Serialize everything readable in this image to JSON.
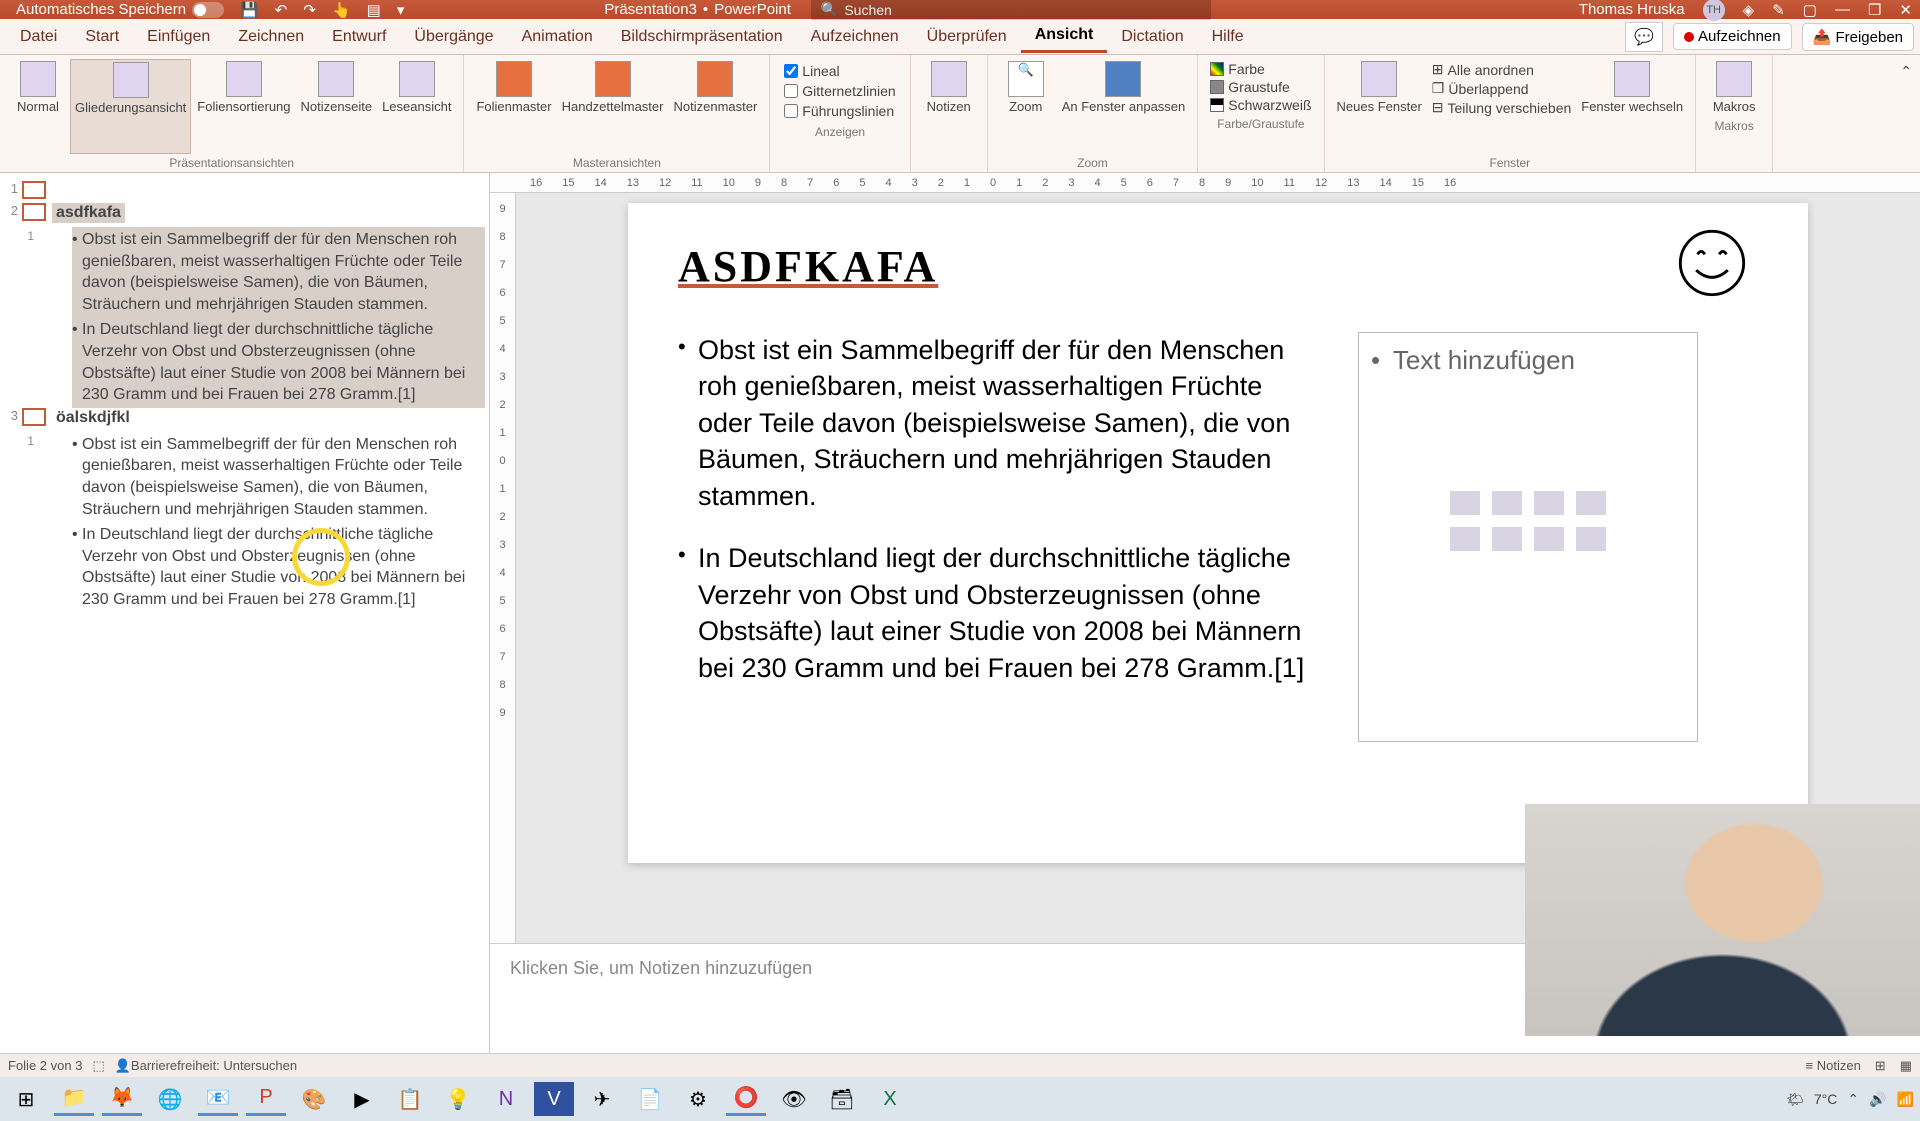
{
  "titlebar": {
    "autosave": "Automatisches Speichern",
    "doc_name": "Präsentation3",
    "app_name": "PowerPoint",
    "search_placeholder": "Suchen",
    "user_name": "Thomas Hruska",
    "user_initials": "TH"
  },
  "tabs": {
    "items": [
      "Datei",
      "Start",
      "Einfügen",
      "Zeichnen",
      "Entwurf",
      "Übergänge",
      "Animation",
      "Bildschirmpräsentation",
      "Aufzeichnen",
      "Überprüfen",
      "Ansicht",
      "Dictation",
      "Hilfe"
    ],
    "active_index": 10,
    "record": "Aufzeichnen",
    "share": "Freigeben"
  },
  "ribbon": {
    "views": {
      "normal": "Normal",
      "outline": "Gliederungsansicht",
      "sort": "Foliensortierung",
      "notes": "Notizenseite",
      "reading": "Leseansicht",
      "group": "Präsentationsansichten"
    },
    "masters": {
      "slide": "Folienmaster",
      "handout": "Handzettelmaster",
      "notes": "Notizenmaster",
      "group": "Masteransichten"
    },
    "show": {
      "ruler": "Lineal",
      "grid": "Gitternetzlinien",
      "guides": "Führungslinien",
      "group": "Anzeigen"
    },
    "notesbtn": "Notizen",
    "zoom": {
      "zoom": "Zoom",
      "fit": "An Fenster anpassen",
      "group": "Zoom"
    },
    "color": {
      "color": "Farbe",
      "gray": "Graustufe",
      "bw": "Schwarzweiß",
      "group": "Farbe/Graustufe"
    },
    "window": {
      "new": "Neues Fenster",
      "all": "Alle anordnen",
      "overlap": "Überlappend",
      "split": "Teilung verschieben",
      "switch": "Fenster wechseln",
      "group": "Fenster"
    },
    "macros": {
      "macros": "Makros",
      "group": "Makros"
    }
  },
  "ruler_h": [
    "16",
    "15",
    "14",
    "13",
    "12",
    "11",
    "10",
    "9",
    "8",
    "7",
    "6",
    "5",
    "4",
    "3",
    "2",
    "1",
    "0",
    "1",
    "2",
    "3",
    "4",
    "5",
    "6",
    "7",
    "8",
    "9",
    "10",
    "11",
    "12",
    "13",
    "14",
    "15",
    "16"
  ],
  "ruler_v": [
    "9",
    "8",
    "7",
    "6",
    "5",
    "4",
    "3",
    "2",
    "1",
    "0",
    "1",
    "2",
    "3",
    "4",
    "5",
    "6",
    "7",
    "8",
    "9"
  ],
  "outline": {
    "slides": [
      {
        "num": "1",
        "title": ""
      },
      {
        "num": "2",
        "title": "asdfkafa",
        "selected": true,
        "bullets": [
          {
            "sel": true,
            "text": "Obst ist ein Sammelbegriff der für den Menschen roh genießbaren, meist wasserhaltigen Früchte oder Teile davon (beispielsweise Samen), die von Bäumen, Sträuchern und mehrjährigen Stauden stammen."
          },
          {
            "sel": true,
            "text": "In Deutschland liegt der durchschnittliche tägliche Verzehr von Obst und Obsterzeugnissen (ohne Obstsäfte) laut einer Studie von 2008 bei Männern bei 230 Gramm und bei Frauen bei 278 Gramm.[1]"
          }
        ]
      },
      {
        "num": "3",
        "title": "öalskdjfkl",
        "selected": false,
        "bullets": [
          {
            "sel": false,
            "text": "Obst ist ein Sammelbegriff der für den Menschen roh genießbaren, meist wasserhaltigen Früchte oder Teile davon (beispielsweise Samen), die von Bäumen, Sträuchern und mehrjährigen Stauden stammen."
          },
          {
            "sel": false,
            "text": "In Deutschland liegt der durchschnittliche tägliche Verzehr von Obst und Obsterzeugnissen (ohne Obstsäfte) laut einer Studie von 2008 bei Männern bei 230 Gramm und bei Frauen bei 278 Gramm.[1]"
          }
        ]
      }
    ]
  },
  "slide": {
    "title": "ASDFKAFA",
    "p1": "Obst ist ein Sammelbegriff der für den Menschen roh genießbaren, meist wasserhaltigen Früchte oder Teile davon (beispielsweise Samen), die von Bäumen, Sträuchern und mehrjährigen Stauden stammen.",
    "p2": "In Deutschland liegt der durchschnittliche tägliche Verzehr von Obst und Obsterzeugnissen (ohne Obstsäfte) laut einer Studie von 2008 bei Männern bei 230 Gramm und bei Frauen bei 278 Gramm.[1]",
    "placeholder": "Text hinzufügen"
  },
  "notes": {
    "placeholder": "Klicken Sie, um Notizen hinzuzufügen"
  },
  "status": {
    "slide": "Folie 2 von 3",
    "lang": "",
    "access": "Barrierefreiheit: Untersuchen",
    "notes": "Notizen"
  },
  "taskbar": {
    "temp": "7°C",
    "time": ""
  }
}
